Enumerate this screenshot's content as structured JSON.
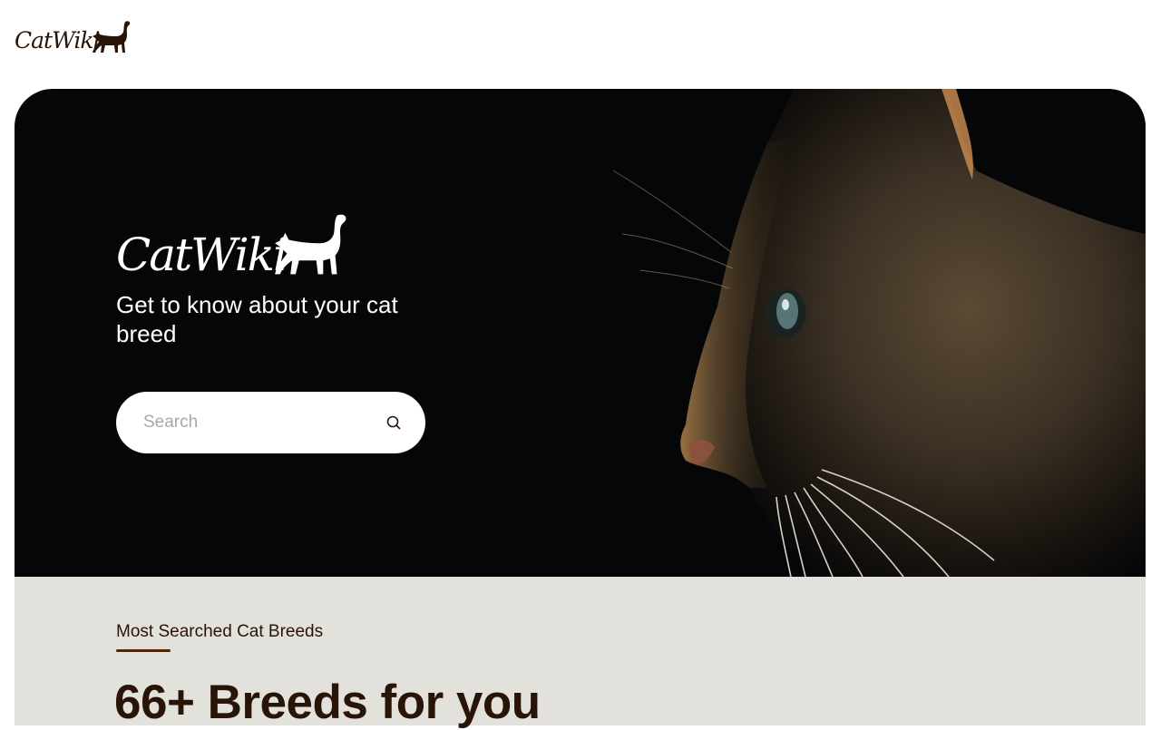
{
  "header": {
    "logo_text": "CatWiki",
    "logo_icon": "cat-silhouette-icon"
  },
  "hero": {
    "logo_text": "CatWiki",
    "logo_icon": "cat-silhouette-icon",
    "tagline": "Get to know about your cat breed",
    "search": {
      "placeholder": "Search",
      "value": "",
      "icon": "search-icon"
    },
    "image": "tabby-cat-profile-photo"
  },
  "breeds_section": {
    "kicker": "Most Searched Cat Breeds",
    "headline": "66+ Breeds for you"
  },
  "colors": {
    "brand_brown": "#291507",
    "accent_brown": "#4d270c",
    "hero_background": "#050608",
    "section_background": "#e3e1dc"
  }
}
